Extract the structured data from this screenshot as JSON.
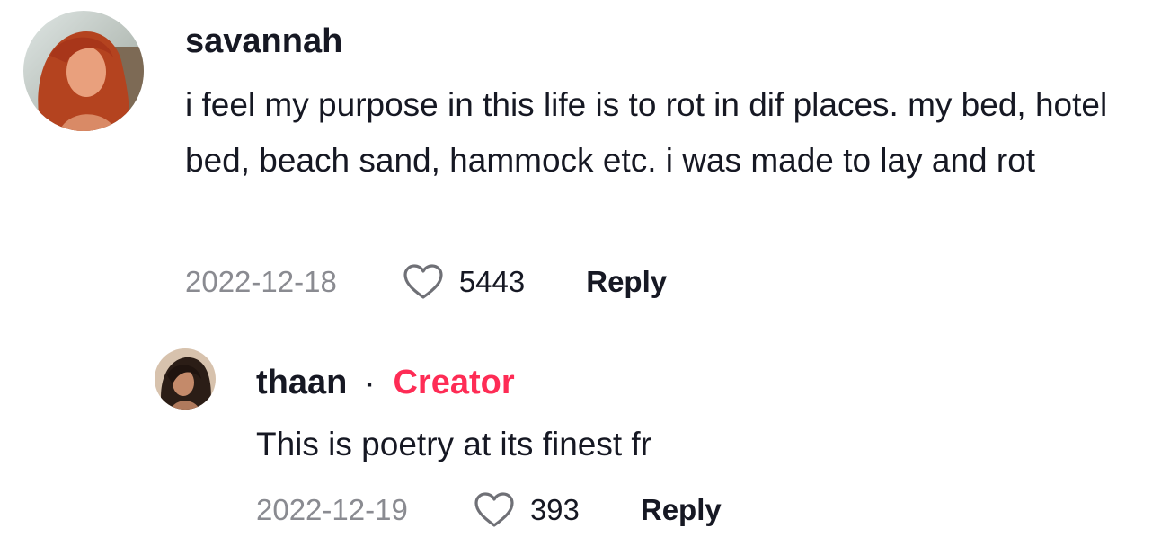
{
  "comments": [
    {
      "username": "savannah",
      "text": "i feel my purpose in this life is to rot in dif places. my bed, hotel bed, beach sand, hammock etc. i was made to lay and rot",
      "date": "2022-12-18",
      "likes": "5443",
      "reply_label": "Reply",
      "icons": {
        "like": "heart-outline-icon"
      }
    }
  ],
  "replies": [
    {
      "username": "thaan",
      "separator": "·",
      "badge": "Creator",
      "text": "This is poetry at its finest fr",
      "date": "2022-12-19",
      "likes": "393",
      "reply_label": "Reply",
      "icons": {
        "like": "heart-outline-icon"
      }
    }
  ],
  "colors": {
    "text_primary": "#161823",
    "text_secondary": "#8a8b91",
    "creator_accent": "#fe2c55"
  }
}
